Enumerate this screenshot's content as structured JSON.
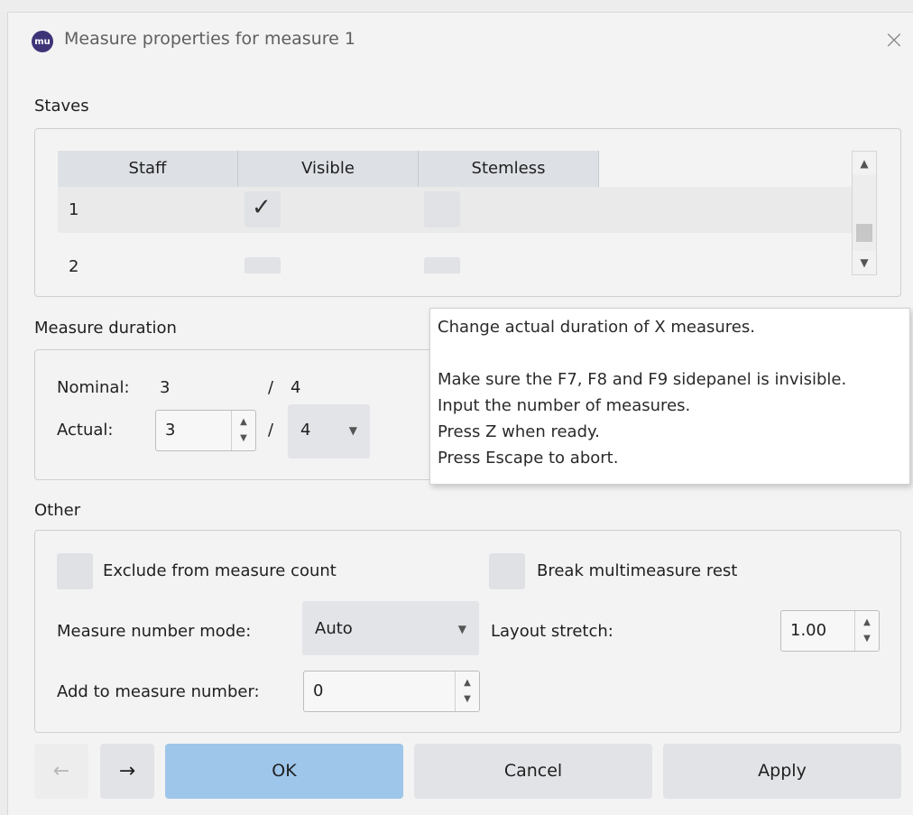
{
  "window": {
    "title": "Measure properties for measure 1",
    "app_icon_text": "mu",
    "close_symbol": "×"
  },
  "staves": {
    "label": "Staves",
    "columns": [
      "Staff",
      "Visible",
      "Stemless"
    ],
    "rows": [
      {
        "staff": "1",
        "visible": true,
        "stemless": false
      },
      {
        "staff": "2",
        "visible": false,
        "stemless": false
      }
    ]
  },
  "duration": {
    "label": "Measure duration",
    "nominal_label": "Nominal:",
    "nominal_num": "3",
    "nominal_slash": "/",
    "nominal_den": "4",
    "actual_label": "Actual:",
    "actual_num": "3",
    "actual_slash": "/",
    "actual_den": "4"
  },
  "tooltip": {
    "lines": [
      "Change actual duration of X measures.",
      "",
      "Make sure the F7, F8 and F9 sidepanel is invisible.",
      "Input the number of measures.",
      "Press Z when ready.",
      "Press Escape to abort."
    ]
  },
  "other": {
    "label": "Other",
    "exclude_label": "Exclude from measure count",
    "break_rest_label": "Break multimeasure rest",
    "number_mode_label": "Measure number mode:",
    "number_mode_value": "Auto",
    "layout_stretch_label": "Layout stretch:",
    "layout_stretch_value": "1.00",
    "add_number_label": "Add to measure number:",
    "add_number_value": "0"
  },
  "buttons": {
    "prev_symbol": "←",
    "next_symbol": "→",
    "ok": "OK",
    "cancel": "Cancel",
    "apply": "Apply"
  },
  "icons": {
    "spin_up": "▲",
    "spin_down": "▼",
    "combo_arrow": "▼",
    "scroll_up": "▲",
    "scroll_down": "▼",
    "check": "✓"
  },
  "colors": {
    "primary_button": "#9ec6ea",
    "app_icon": "#3d3478"
  }
}
